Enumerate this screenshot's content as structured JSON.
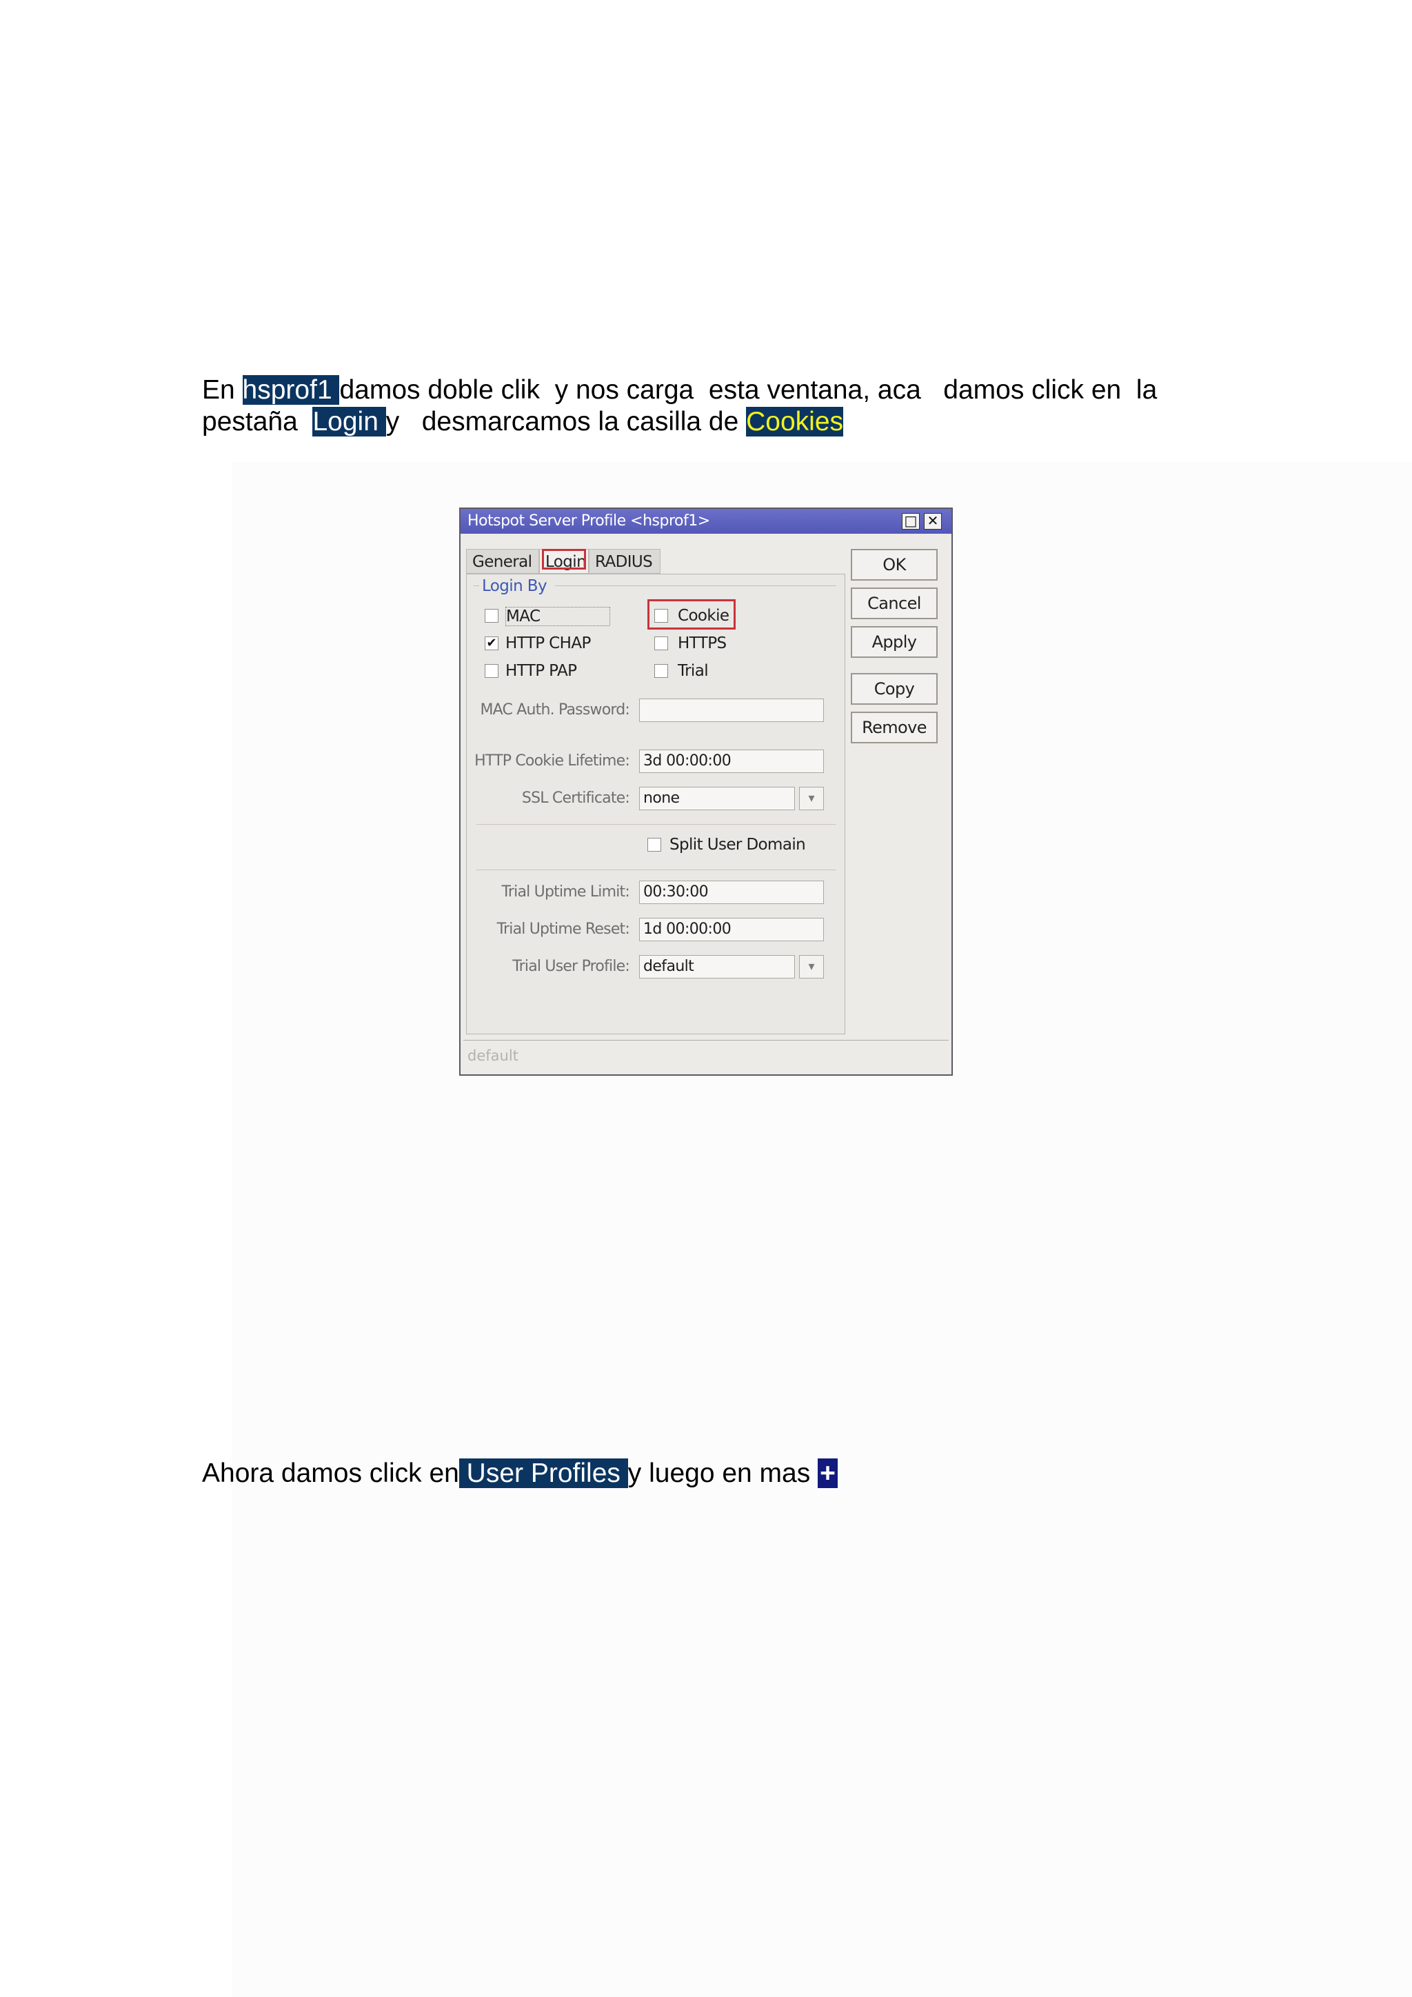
{
  "paragraph1": {
    "line1": {
      "pre": "En ",
      "hl": "hsprof1 ",
      "post": "damos doble clik  y nos carga  esta ventana, aca   damos click en  la"
    },
    "line2": {
      "pre": "pestaña  ",
      "hl": "Login ",
      "mid": "y   desmarcamos la casilla de ",
      "hl2": "Cookies"
    }
  },
  "dialog": {
    "title": "Hotspot Server Profile <hsprof1>",
    "tabs": [
      "General",
      "Login",
      "RADIUS"
    ],
    "active_tab": "Login",
    "group_label": "Login By",
    "checkboxes": {
      "mac": {
        "label": "MAC",
        "checked": false
      },
      "http_chap": {
        "label": "HTTP CHAP",
        "checked": true
      },
      "http_pap": {
        "label": "HTTP PAP",
        "checked": false
      },
      "cookie": {
        "label": "Cookie",
        "checked": false
      },
      "https": {
        "label": "HTTPS",
        "checked": false
      },
      "trial": {
        "label": "Trial",
        "checked": false
      },
      "split_user_domain": {
        "label": "Split User Domain",
        "checked": false
      }
    },
    "check_mark": "✔",
    "fields": {
      "mac_auth_password": {
        "label": "MAC Auth. Password:",
        "value": ""
      },
      "http_cookie_lifetime": {
        "label": "HTTP Cookie Lifetime:",
        "value": "3d 00:00:00"
      },
      "ssl_certificate": {
        "label": "SSL Certificate:",
        "value": "none"
      },
      "trial_uptime_limit": {
        "label": "Trial Uptime Limit:",
        "value": "00:30:00"
      },
      "trial_uptime_reset": {
        "label": "Trial Uptime Reset:",
        "value": "1d 00:00:00"
      },
      "trial_user_profile": {
        "label": "Trial User Profile:",
        "value": "default"
      }
    },
    "buttons": {
      "ok": "OK",
      "cancel": "Cancel",
      "apply": "Apply",
      "copy": "Copy",
      "remove": "Remove"
    },
    "status": "default",
    "highlight_color": "#c9333a"
  },
  "paragraph2": {
    "pre": "Ahora damos click en",
    "hl": " User Profiles ",
    "mid": "y luego en mas ",
    "plus": "+"
  },
  "colors": {
    "highlight_bg": "#0b3560",
    "highlight_yellow_text": "#f2f21e",
    "plus_bg": "#121a7d",
    "titlebar": "#5a5fbf"
  }
}
